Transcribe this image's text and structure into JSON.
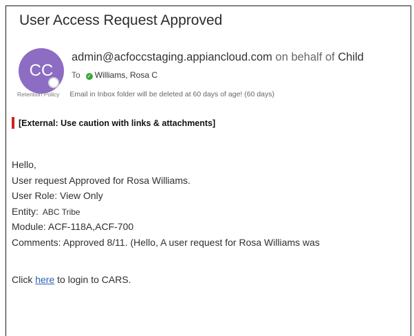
{
  "email": {
    "subject": "User Access Request Approved",
    "avatar_initials": "CC",
    "sender": "admin@acfoccstaging.appiancloud.com",
    "on_behalf": "on behalf of",
    "on_behalf_name": "Child",
    "to_label": "To",
    "recipient": "Williams, Rosa C",
    "retention_label": "Retention Policy",
    "retention_text": "Email in Inbox folder will be deleted at 60 days of age! (60 days)",
    "external_warning": "[External: Use caution with links & attachments]",
    "body": {
      "greeting": "Hello,",
      "line1": "User request Approved for Rosa Williams.",
      "role_line": "User Role: View Only",
      "entity_label": "Entity:",
      "entity_value": "ABC Tribe",
      "module_line": "Module: ACF-118A,ACF-700",
      "comments_line": "Comments: Approved 8/11. (Hello, A user request for Rosa Williams was"
    },
    "footer": {
      "prefix": "Click",
      "link": "here",
      "suffix": "to login to CARS."
    }
  },
  "colors": {
    "avatar_bg": "#8d6cc3",
    "status_green": "#3aa53a",
    "warning_bar": "#d02020",
    "link": "#2a5fb0"
  }
}
